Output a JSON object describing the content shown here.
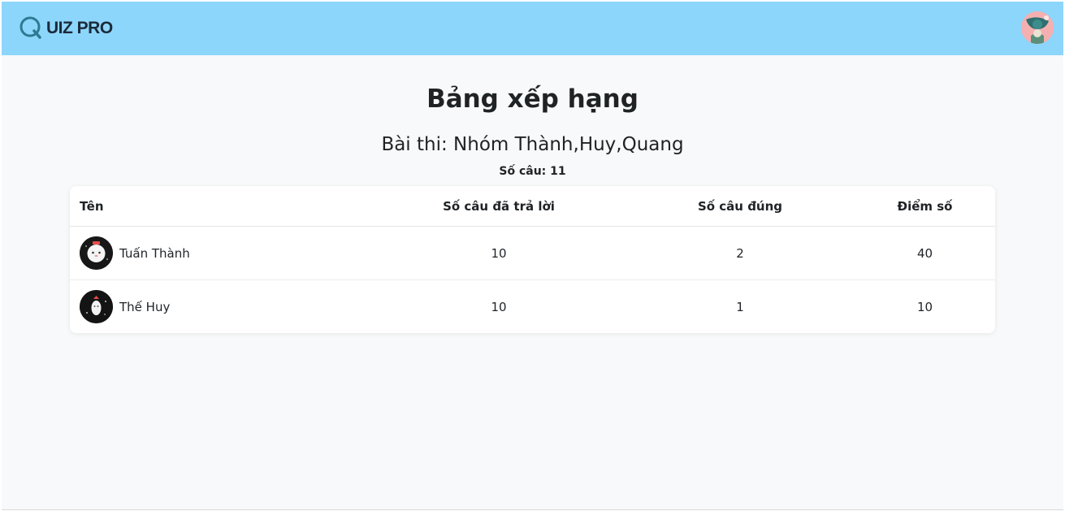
{
  "app": {
    "brand_text": "UIZ PRO",
    "brand_icon": "q-logo-icon",
    "user_avatar_icon": "profile-avatar-icon",
    "colors": {
      "navbar": "#8dd6fb",
      "background": "#f8f9fa",
      "card": "#ffffff"
    }
  },
  "page": {
    "title": "Bảng xếp hạng",
    "exam_title": "Bài thi: Nhóm Thành,Huy,Quang",
    "question_count_label": "Số câu:",
    "question_count": "11"
  },
  "table": {
    "headers": {
      "name": "Tên",
      "answered": "Số câu đã trả lời",
      "correct": "Số câu đúng",
      "score": "Điểm số"
    },
    "rows": [
      {
        "name": "Tuấn Thành",
        "answered": "10",
        "correct": "2",
        "score": "40",
        "avatar": "white-cat-avatar-icon"
      },
      {
        "name": "Thế Huy",
        "answered": "10",
        "correct": "1",
        "score": "10",
        "avatar": "ghost-avatar-icon"
      }
    ]
  }
}
